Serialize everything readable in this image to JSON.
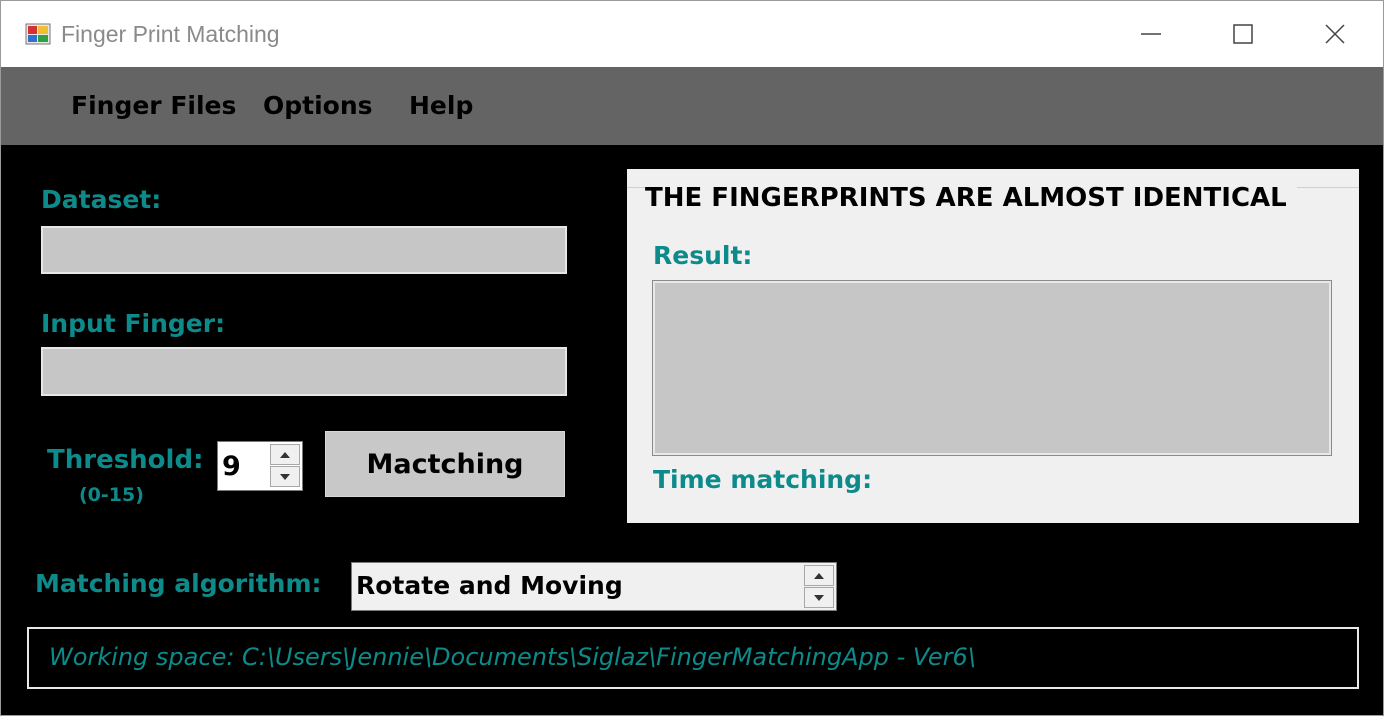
{
  "window": {
    "title": "Finger Print Matching",
    "icon": "app-icon",
    "controls": [
      "minimize-icon",
      "maximize-icon",
      "close-icon"
    ]
  },
  "menu": {
    "items": [
      "Finger Files",
      "Options",
      "Help"
    ]
  },
  "form": {
    "dataset_label": "Dataset:",
    "dataset_value": "",
    "input_label": "Input Finger:",
    "input_value": "",
    "threshold_label": "Threshold:",
    "threshold_range": "(0-15)",
    "threshold_value": "9",
    "match_button": "Mactching",
    "algorithm_label": "Matching algorithm:",
    "algorithm_value": "Rotate and Moving"
  },
  "result": {
    "heading": "THE FINGERPRINTS ARE ALMOST IDENTICAL",
    "result_label": "Result:",
    "result_value": "",
    "time_label": "Time matching:"
  },
  "status": {
    "workspace": "Working space: C:\\Users\\Jennie\\Documents\\Siglaz\\FingerMatchingApp - Ver6\\"
  },
  "colors": {
    "accent": "#0d8a8a",
    "background": "#000000",
    "menubar": "#646464",
    "panel": "#f0f0f0",
    "field": "#c6c6c6"
  }
}
